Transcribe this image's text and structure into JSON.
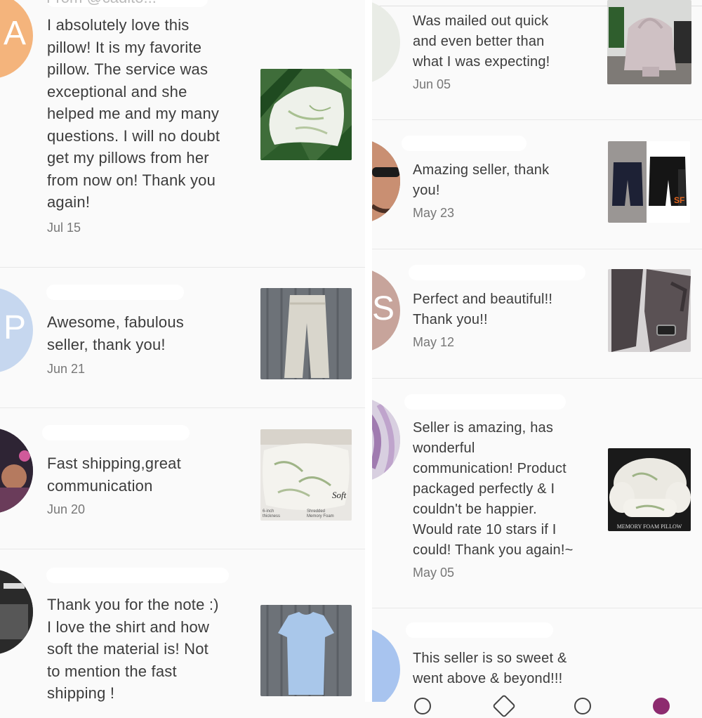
{
  "top_name_fragment": "From @cadito...",
  "left_reviews": [
    {
      "text": "I absolutely love this\npillow! It is my favorite\npillow. The service was\nexceptional and she\nhelped me and my many\nquestions. I will no doubt\nget my pillows from her\nfrom now on! Thank you\nagain!",
      "date": "Jul 15",
      "avatar_letter": "A",
      "avatar_color": "#f4b47c"
    },
    {
      "text": "Awesome, fabulous\nseller, thank you!",
      "date": "Jun 21",
      "avatar_letter": "P",
      "avatar_color": "#c6d7ef"
    },
    {
      "text": "Fast shipping,great\ncommunication",
      "date": "Jun 20",
      "avatar_letter": "",
      "avatar_color": "#4a3550"
    },
    {
      "text": "Thank you for the note :)\nI love the shirt and how\nsoft the material is! Not\nto mention the fast\nshipping !",
      "date": "",
      "avatar_letter": "",
      "avatar_color": "#3a3a3a"
    }
  ],
  "right_reviews": [
    {
      "text": "Was mailed out quick\nand even better than\nwhat I was expecting!",
      "date": "Jun 05",
      "avatar_letter": "",
      "avatar_color": "#e9ece6"
    },
    {
      "text": "Amazing seller, thank\nyou!",
      "date": "May 23",
      "avatar_letter": "",
      "avatar_color": "#8a5a45"
    },
    {
      "text": "Perfect and beautiful!!\nThank you!!",
      "date": "May 12",
      "avatar_letter": "S",
      "avatar_color": "#c7a49b"
    },
    {
      "text": "Seller is amazing, has\nwonderful\ncommunication! Product\npackaged perfectly & I\ncouldn't be happier.\nWould rate 10 stars if I\ncould! Thank you again!~",
      "date": "May 05",
      "avatar_letter": "",
      "avatar_color": "#c9b8cf"
    },
    {
      "text": "This seller is so sweet &\nwent above & beyond!!!",
      "date": "",
      "avatar_letter": "",
      "avatar_color": "#a8c4ef"
    }
  ],
  "product_labels": {
    "pillow_brand": "Soft",
    "pillow_left": "6-inch\nthickness",
    "pillow_right": "Shredded\nMemory Foam",
    "memory_foam": "MEMORY FOAM PILLOW"
  },
  "icons": [
    "avatar",
    "pillow-photo",
    "pants-photo",
    "shirt-photo",
    "bag-photo",
    "shorts-photo",
    "shoes-photo"
  ]
}
